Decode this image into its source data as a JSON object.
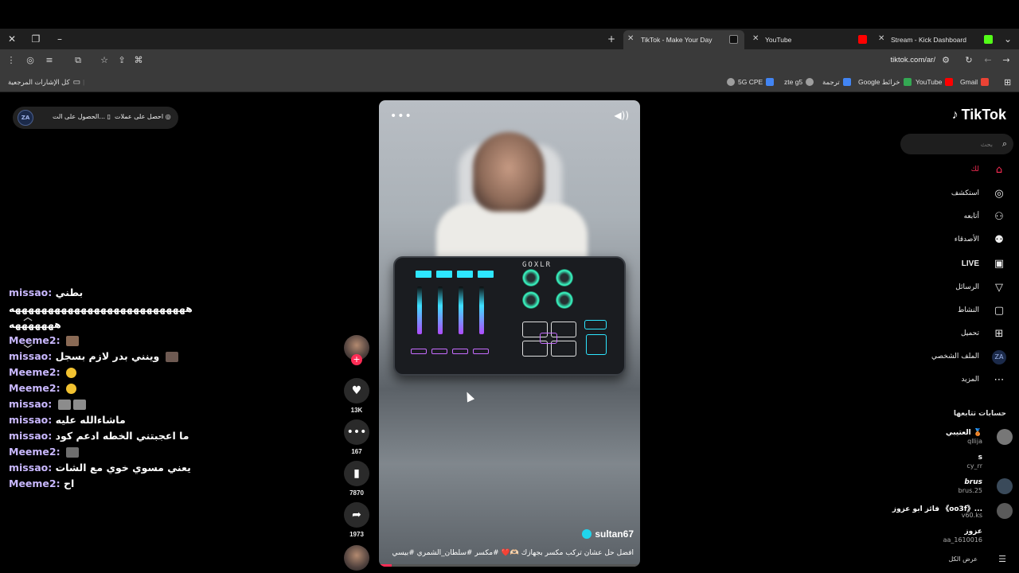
{
  "browser": {
    "tabs": [
      {
        "title": "TikTok - Make Your Day",
        "active": true,
        "favicon_color": "#111111"
      },
      {
        "title": "YouTube",
        "active": false,
        "favicon_color": "#ff0000"
      },
      {
        "title": "Stream - Kick Dashboard",
        "active": false,
        "favicon_color": "#53fc18"
      }
    ],
    "url": "tiktok.com/ar/",
    "bookmarks": [
      {
        "label": "Gmail",
        "color": "#ea4335"
      },
      {
        "label": "YouTube",
        "color": "#ff0000"
      },
      {
        "label": "Google خرائط",
        "color": "#34a853"
      },
      {
        "label": "ترجمة",
        "color": "#4285f4"
      },
      {
        "label": "zte g5",
        "color": "#9e9e9e"
      },
      {
        "label": "5G CPE",
        "color": "#4285f4"
      },
      {
        "label": "",
        "color": "#9e9e9e"
      }
    ],
    "all_bookmarks": "كل الإشارات المرجعية"
  },
  "promo": {
    "coins": "احصل على عملات",
    "get_app": "الحصول على الت...",
    "avatar_text": "ZA"
  },
  "chat": [
    {
      "user": "missao:",
      "text": "بطني",
      "emote_color": ""
    },
    {
      "user": "",
      "text": "هههههههههههههههههههههههههههه",
      "emote_color": ""
    },
    {
      "user": "",
      "text": "هههههههه",
      "emote_color": ""
    },
    {
      "user": "Meeme2:",
      "text": "",
      "emote_color": "#8a6a55"
    },
    {
      "user": "missao:",
      "text": "وينني بدر لازم بسجل",
      "emote_color": "#6e5a52"
    },
    {
      "user": "Meeme2:",
      "text": "",
      "emote_color": "#f2c230"
    },
    {
      "user": "Meeme2:",
      "text": "",
      "emote_color": "#f2c230"
    },
    {
      "user": "missao:",
      "text": "",
      "emote_color": "#8c8c8c"
    },
    {
      "user": "missao:",
      "text": "ماشاءالله عليه",
      "emote_color": ""
    },
    {
      "user": "missao:",
      "text": "ما اعجبتني الخطه ادعم كود",
      "emote_color": ""
    },
    {
      "user": "Meeme2:",
      "text": "",
      "emote_color": "#6f6f6f"
    },
    {
      "user": "missao:",
      "text": "يعني مسوي خوي مع الشات",
      "emote_color": ""
    },
    {
      "user": "Meeme2:",
      "text": "اح",
      "emote_color": ""
    }
  ],
  "video": {
    "author": "sultan67",
    "caption": "افضل حل عشان تركب مكسر بجهازك 🫶🏻❤️ #مكسر #سلطان_الشمري #بيسي",
    "mixer_brand": "GOXLR",
    "progress": 0.05
  },
  "actions": {
    "likes": "13K",
    "comments": "167",
    "saves": "7870",
    "shares": "1973"
  },
  "sidebar": {
    "brand": "TikTok",
    "search_placeholder": "بحث",
    "nav": [
      {
        "label": "لك",
        "icon": "home-icon"
      },
      {
        "label": "استكشف",
        "icon": "compass-icon"
      },
      {
        "label": "أتابعه",
        "icon": "user-plus-icon"
      },
      {
        "label": "الأصدقاء",
        "icon": "friends-icon"
      },
      {
        "label": "LIVE",
        "icon": "live-icon"
      },
      {
        "label": "الرسائل",
        "icon": "send-icon"
      },
      {
        "label": "النشاط",
        "icon": "activity-icon"
      },
      {
        "label": "تحميل",
        "icon": "upload-icon"
      },
      {
        "label": "الملف الشخصي",
        "icon": "profile-icon"
      },
      {
        "label": "المزيد",
        "icon": "more-icon"
      }
    ],
    "following_title": "حسابات تتابعها",
    "following": [
      {
        "name": "العتيبي 🥉",
        "handle": "qllija"
      },
      {
        "name": "s",
        "handle": "cy_rr"
      },
      {
        "name": "brus",
        "handle": "brus.25"
      },
      {
        "name": "فائز ابو عزوز 《oo3f》...",
        "handle": "v60.ks"
      },
      {
        "name": "عزوز",
        "handle": "aa_1610016"
      }
    ],
    "see_all": "عرض الكل"
  }
}
